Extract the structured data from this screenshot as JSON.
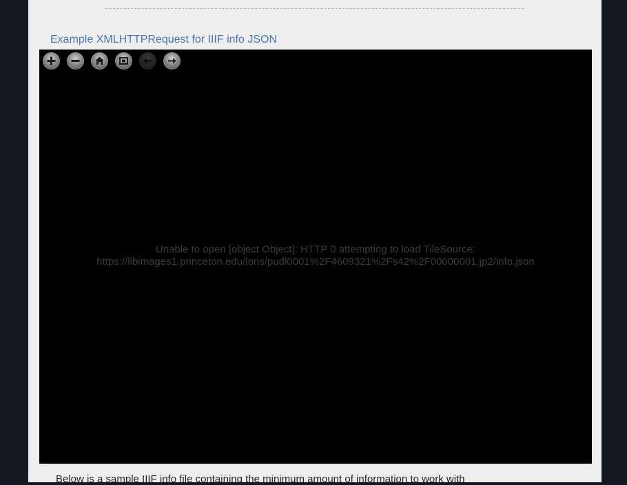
{
  "section": {
    "title": "Example XMLHTTPRequest for IIIF info JSON"
  },
  "viewer": {
    "toolbar": [
      {
        "name": "zoom-in",
        "icon": "plus-icon",
        "enabled": true
      },
      {
        "name": "zoom-out",
        "icon": "minus-icon",
        "enabled": true
      },
      {
        "name": "home",
        "icon": "home-icon",
        "enabled": true
      },
      {
        "name": "full-page",
        "icon": "fullpage-icon",
        "enabled": true
      },
      {
        "name": "previous",
        "icon": "arrow-left-icon",
        "enabled": false
      },
      {
        "name": "next",
        "icon": "arrow-right-icon",
        "enabled": true
      }
    ],
    "error_line1": "Unable to open [object Object]: HTTP 0 attempting to load TileSource:",
    "error_line2": "https://libimages1.princeton.edu/loris/pudl0001%2F4609321%2Fs42%2F00000001.jp2/info.json"
  },
  "body": {
    "intro": "Below is a sample IIIF info file containing the minimum amount of information to work with"
  },
  "colors": {
    "frame_background": "#151822",
    "page_background": "#eeeeee",
    "link_blue": "#4a76b5",
    "viewer_background": "#000000"
  }
}
